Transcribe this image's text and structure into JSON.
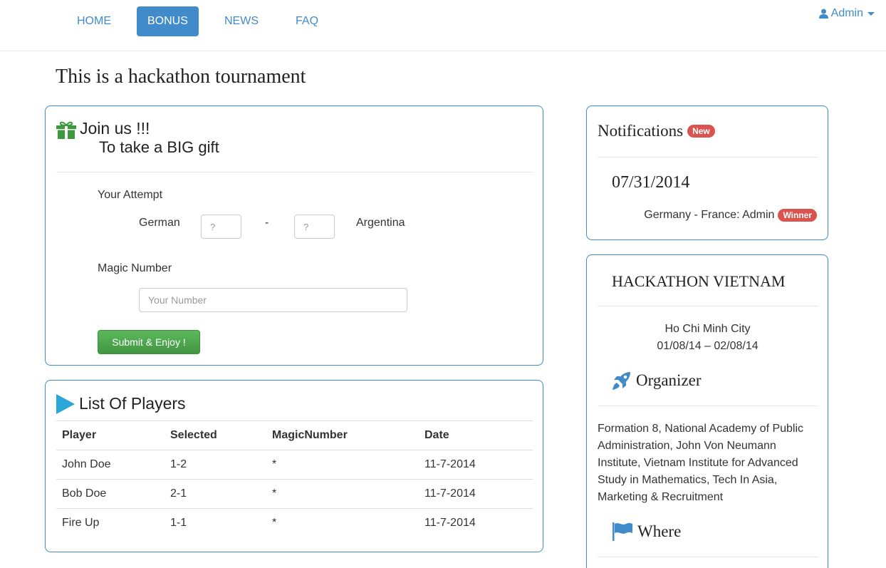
{
  "nav": {
    "items": [
      {
        "label": "HOME",
        "active": false
      },
      {
        "label": "BONUS",
        "active": true
      },
      {
        "label": "NEWS",
        "active": false
      },
      {
        "label": "FAQ",
        "active": false
      }
    ],
    "user": {
      "label": "Admin",
      "icon": "user-icon"
    }
  },
  "page_title": "This is a hackathon tournament",
  "join": {
    "icon": "gift-icon",
    "title": "Join us !!!",
    "subtitle": "To take a BIG gift",
    "attempt_label": "Your Attempt",
    "team_home": "German",
    "team_away": "Argentina",
    "score_separator": "-",
    "score_home_placeholder": "?",
    "score_away_placeholder": "?",
    "magic_label": "Magic Number",
    "magic_placeholder": "Your Number",
    "submit_label": "Submit & Enjoy !"
  },
  "players": {
    "icon": "play-icon",
    "title": "List Of Players",
    "columns": [
      "Player",
      "Selected",
      "MagicNumber",
      "Date"
    ],
    "rows": [
      {
        "player": "John Doe",
        "selected": "1-2",
        "magic": "*",
        "date": "11-7-2014"
      },
      {
        "player": "Bob Doe",
        "selected": "2-1",
        "magic": "*",
        "date": "11-7-2014"
      },
      {
        "player": "Fire Up",
        "selected": "1-1",
        "magic": "*",
        "date": "11-7-2014"
      }
    ]
  },
  "notifications": {
    "title": "Notifications",
    "badge": "New",
    "date": "07/31/2014",
    "item": "Germany - France: Admin",
    "item_badge": "Winner"
  },
  "event": {
    "title": "HACKATHON VIETNAM",
    "city": "Ho Chi Minh City",
    "dates": "01/08/14 – 02/08/14",
    "organizer_heading": "Organizer",
    "organizer_icon": "rocket-icon",
    "organizer_text": "Formation 8, National Academy of Public Administration, John Von Neumann Institute, Vietnam Institute for Advanced Study in Mathematics, Tech In Asia, Marketing & Recruitment",
    "where_heading": "Where",
    "where_icon": "flag-icon"
  },
  "colors": {
    "primary": "#428bca",
    "success": "#5cb85c",
    "danger": "#d9534f",
    "gift": "#3c9a3c",
    "play": "#2aa7d8"
  }
}
